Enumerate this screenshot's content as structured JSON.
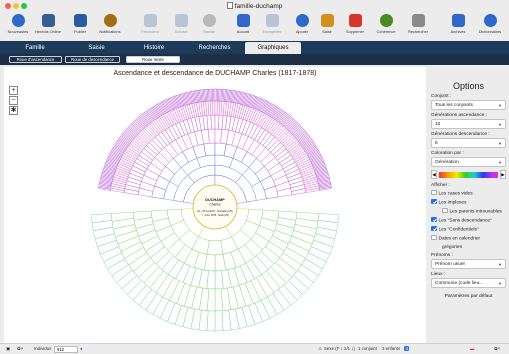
{
  "window": {
    "title": "famille-duchamp"
  },
  "toolbar": [
    {
      "label": "Nouveautés",
      "icon": "gift-icon",
      "color": "#2f68c8",
      "enabled": true
    },
    {
      "label": "Heredis Online",
      "icon": "cloud-book-icon",
      "color": "#355e91",
      "enabled": true
    },
    {
      "label": "Publier",
      "icon": "publish-icon",
      "color": "#2a5aa0",
      "enabled": true
    },
    {
      "label": "Notifications",
      "icon": "bell-chat-icon",
      "color": "#a07010",
      "enabled": true
    },
    {
      "label": "Précédent",
      "icon": "arrow-left-icon",
      "color": "#b9c4d4",
      "enabled": false
    },
    {
      "label": "Suivant",
      "icon": "arrow-right-icon",
      "color": "#b9c4d4",
      "enabled": false
    },
    {
      "label": "Racine",
      "icon": "root-person-icon",
      "color": "#b9b9b9",
      "enabled": false
    },
    {
      "label": "Accueil",
      "icon": "home-icon",
      "color": "#2f68c8",
      "enabled": true
    },
    {
      "label": "Enregistrer",
      "icon": "save-icon",
      "color": "#b9c4d4",
      "enabled": false
    },
    {
      "label": "Ajouter",
      "icon": "plus-icon",
      "color": "#2f68c8",
      "enabled": true
    },
    {
      "label": "Saisir",
      "icon": "pencil-icon",
      "color": "#d09020",
      "enabled": true
    },
    {
      "label": "Supprimer",
      "icon": "delete-x-icon",
      "color": "#d9332b",
      "enabled": true
    },
    {
      "label": "Cohérence",
      "icon": "check-coherence-icon",
      "color": "#4a8a22",
      "enabled": true
    },
    {
      "label": "Rechercher",
      "icon": "search-icon",
      "color": "#8a8a8a",
      "enabled": true
    },
    {
      "label": "Archives",
      "icon": "archives-icon",
      "color": "#2f68c8",
      "enabled": true
    },
    {
      "label": "Dictionnaires",
      "icon": "dictionary-icon",
      "color": "#2f68c8",
      "enabled": true
    }
  ],
  "tabs": [
    {
      "label": "Famille",
      "active": false
    },
    {
      "label": "Saisie",
      "active": false
    },
    {
      "label": "Histoire",
      "active": false
    },
    {
      "label": "Recherches",
      "active": false
    },
    {
      "label": "Graphiques",
      "active": true
    }
  ],
  "subtabs": [
    {
      "label": "Roue d'ascendance",
      "active": false
    },
    {
      "label": "Roue de descendance",
      "active": false
    },
    {
      "label": "Roue mixte",
      "active": true
    }
  ],
  "chart": {
    "title": "Ascendance et descendance de DUCHAMP Charles (1817-1878)",
    "center": {
      "surname": "DUCHAMP",
      "given": "Charles",
      "birth": "Né : 06 Juil 1817 - Pontarlier (25)",
      "death": "† : 4 Avr 1878 - Nods (25)"
    },
    "zoom_in": "+",
    "zoom_out": "−",
    "zoom_reset": "✱"
  },
  "options": {
    "title": "Options",
    "conjoint_label": "Conjoint :",
    "conjoint_value": "Tous les conjoints",
    "gen_asc_label": "Générations ascendance :",
    "gen_asc_value": "10",
    "gen_desc_label": "Générations descendance :",
    "gen_desc_value": "6",
    "coloration_label": "Coloration par :",
    "coloration_value": "Génération",
    "afficher_label": "Afficher :",
    "checks": [
      {
        "label": "Les cases vides",
        "checked": false
      },
      {
        "label": "Les implexes",
        "checked": true
      },
      {
        "label": "Les parents introuvables",
        "checked": false,
        "indent": true
      },
      {
        "label": "Les \"Sans descendance\"",
        "checked": true
      },
      {
        "label": "Les \"Confidentiels\"",
        "checked": true
      },
      {
        "label": "Dates en calendrier",
        "checked": false
      },
      {
        "label": "grégorien",
        "checked": null,
        "indent": true
      }
    ],
    "prenoms_label": "Prénoms :",
    "prenoms_value": "Prénom usuel",
    "lieux_label": "Lieux :",
    "lieux_value": "Commune (code lieu...",
    "default_link": "Paramètres par défaut"
  },
  "status": {
    "individus_label": "Individus",
    "individus_value": "812",
    "center_info": "Sexe (F ↕ 2/1 ↕)",
    "conjoint_info": "1 conjoint",
    "enfants_info": "3 enfants",
    "enfants_badge": "3"
  },
  "colors": {
    "navy": "#1c3b5a",
    "gen1": "#b04fd0",
    "gen2": "#4f5fe0",
    "gen3": "#4a90e0",
    "gen4": "#e04fd0",
    "desc1": "#e0c84f",
    "desc2": "#7fcf5f",
    "desc3": "#5fcf8f"
  }
}
